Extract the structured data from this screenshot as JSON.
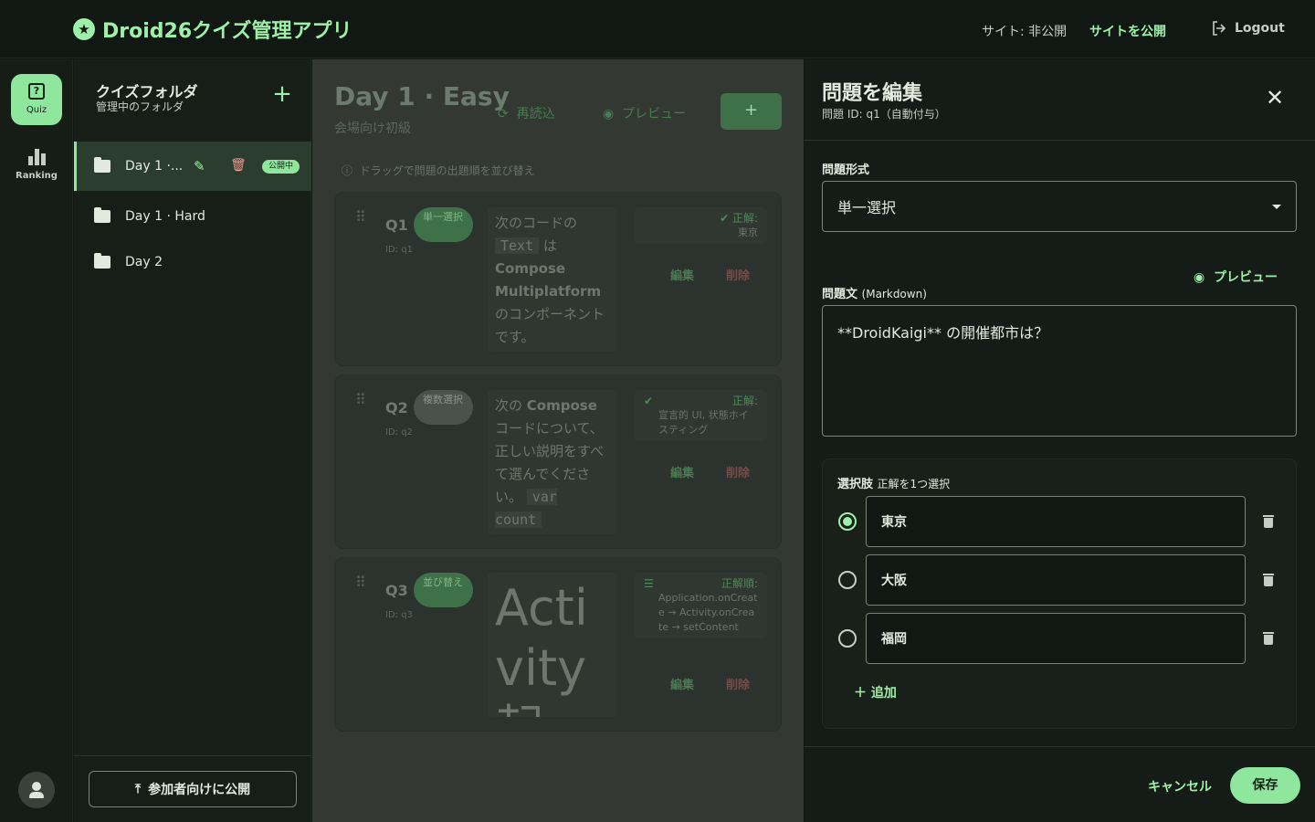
{
  "app": {
    "title": "Droid26クイズ管理アプリ",
    "site_status": "サイト: 非公開",
    "publish_site": "サイトを公開",
    "logout": "Logout"
  },
  "rail": {
    "quiz_label": "Quiz",
    "ranking_label": "Ranking"
  },
  "folders": {
    "title": "クイズフォルダ",
    "subtitle": "管理中のフォルダ",
    "add": "+",
    "items": [
      {
        "name": "Day 1 ·...",
        "badge": "公開中",
        "active": true
      },
      {
        "name": "Day 1 · Hard"
      },
      {
        "name": "Day 2"
      }
    ],
    "publish_button": "参加者向けに公開"
  },
  "main": {
    "title": "Day 1 · Easy",
    "subtitle": "会場向け初級",
    "reload": "再読込",
    "preview": "プレビュー",
    "add": "+",
    "hint": "ドラッグで問題の出題順を並び替え",
    "questions": [
      {
        "num": "Q1",
        "id": "ID: q1",
        "type": "単一選択",
        "text_parts": [
          "次のコードの",
          "Text",
          "は",
          "Compose Multiplatform",
          "のコンポーネントです。"
        ],
        "answer_label": "正解:",
        "answer_value": "東京",
        "edit": "編集",
        "delete": "削除"
      },
      {
        "num": "Q2",
        "id": "ID: q2",
        "type": "複数選択",
        "text_parts": [
          "次の",
          "Compose",
          "コードについて、正しい説明をすべて選んでください。",
          "var count"
        ],
        "answer_label": "正解:",
        "answer_value": "宣言的 UI, 状態ホイスティング",
        "edit": "編集",
        "delete": "削除"
      },
      {
        "num": "Q3",
        "id": "ID: q3",
        "type": "並び替え",
        "text_parts": [
          "Activity 起"
        ],
        "answer_label": "正解順:",
        "answer_value": "Application.onCreate → Activity.onCreate → setContent",
        "edit": "編集",
        "delete": "削除"
      }
    ]
  },
  "editor": {
    "title": "問題を編集",
    "subtitle": "問題 ID: q1（自動付与）",
    "format_label": "問題形式",
    "format_value": "単一選択",
    "preview": "プレビュー",
    "text_label": "問題文",
    "text_label_note": "(Markdown)",
    "text_value": "**DroidKaigi** の開催都市は？",
    "choices_label": "選択肢",
    "choices_note": "正解を1つ選択",
    "choices": [
      {
        "label": "東京",
        "correct": true
      },
      {
        "label": "大阪",
        "correct": false
      },
      {
        "label": "福岡",
        "correct": false
      }
    ],
    "add_choice": "追加",
    "cancel": "キャンセル",
    "save": "保存"
  },
  "colors": {
    "accent": "#9ef0a8",
    "accent_strong": "#8fe69d",
    "danger": "#f19a95",
    "background": "#111712"
  }
}
